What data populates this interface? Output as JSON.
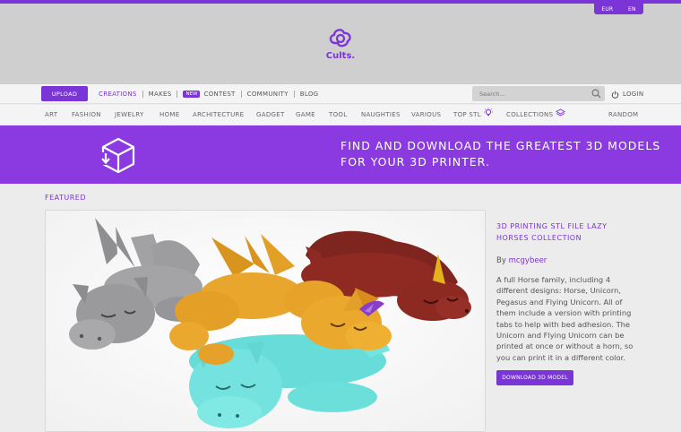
{
  "header": {
    "currencies": [
      "EUR",
      "EN"
    ],
    "logo_text": "Cults."
  },
  "nav": {
    "upload_label": "UPLOAD",
    "items": [
      "CREATIONS",
      "MAKES",
      "CONTEST",
      "COMMUNITY",
      "BLOG"
    ],
    "new_badge": "NEW",
    "search_placeholder": "Search...",
    "login_label": "LOGIN"
  },
  "categories": [
    "ART",
    "FASHION",
    "JEWELRY",
    "HOME",
    "ARCHITECTURE",
    "GADGET",
    "GAME",
    "TOOL",
    "NAUGHTIES",
    "VARIOUS",
    "TOP STL",
    "COLLECTIONS",
    "RANDOM"
  ],
  "banner": {
    "line1": "FIND AND DOWNLOAD THE GREATEST 3D MODELS",
    "line2": "FOR YOUR 3D PRINTER."
  },
  "featured": {
    "label": "FEATURED",
    "title": "3D PRINTING STL FILE LAZY HORSES COLLECTION",
    "by_prefix": "By",
    "author": "mcgybeer",
    "description": "A full Horse family, including 4 different designs: Horse, Unicorn, Pegasus and Flying Unicorn. All of them include a version with printing tabs to help with bed adhesion. The Unicorn and Flying Unicorn can be printed at once or without a horn, so you can print it in a different color.",
    "button_label": "DOWNLOAD 3D MODEL"
  },
  "colors": {
    "accent": "#7b34d6",
    "banner": "#8a3ae0",
    "header_bg": "#cfcfcf",
    "horse_gray": "#9a9a9c",
    "horse_yellow": "#e8a42a",
    "horse_red": "#8e2a22",
    "horse_cyan": "#6fe0dc"
  }
}
